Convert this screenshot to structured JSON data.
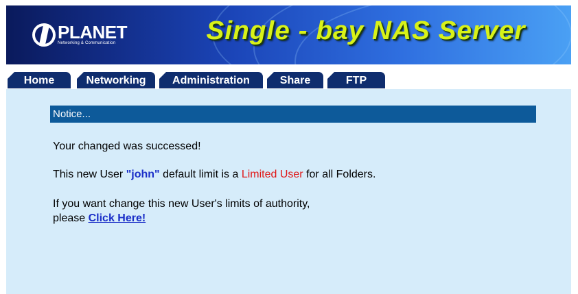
{
  "brand": {
    "logo_name": "PLANET",
    "logo_tagline": "Networking & Communication",
    "title": "Single - bay NAS Server"
  },
  "tabs": [
    {
      "label": "Home"
    },
    {
      "label": "Networking"
    },
    {
      "label": "Administration"
    },
    {
      "label": "Share"
    },
    {
      "label": "FTP"
    }
  ],
  "notice": {
    "header": "Notice...",
    "success": "Your changed was successed!",
    "line2_prefix": "This new User",
    "username": "\"john\"",
    "line2_middle": "default limit is a",
    "role": "Limited User",
    "line2_suffix": "for all Folders.",
    "line3": "If you want change this new User's limits of authority,",
    "line4_prefix": "please",
    "link_label": "Click Here!"
  },
  "colors": {
    "tab_bg": "#0f2d6e",
    "content_bg": "#d6ecfa",
    "notice_bar": "#0d5a9a",
    "title_yellow": "#d8f218",
    "username_blue": "#1a2ec8",
    "role_red": "#e01818"
  }
}
